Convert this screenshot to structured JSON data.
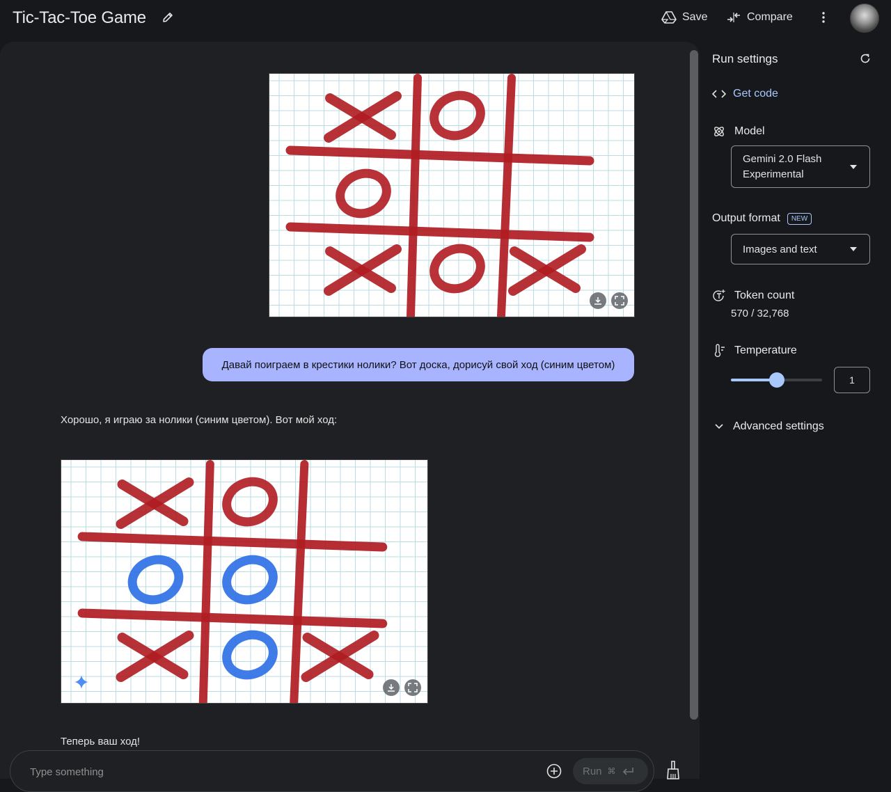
{
  "header": {
    "title": "Tic-Tac-Toe Game",
    "save_label": "Save",
    "compare_label": "Compare"
  },
  "chat": {
    "user_message": "Давай поиграем в крестики нолики? Вот доска, дорисуй свой ход (синим цветом)",
    "model_reply": "Хорошо, я играю за нолики (синим цветом). Вот мой ход:",
    "model_footer": "Теперь ваш ход!",
    "board_before": [
      "X",
      "O",
      "",
      "O",
      "",
      "",
      "X",
      "O",
      "X"
    ],
    "board_after": [
      "X",
      "O",
      "",
      "O",
      "O",
      "",
      "X",
      "O",
      "X"
    ],
    "board_after_blue": [
      false,
      false,
      false,
      true,
      true,
      false,
      false,
      true,
      false
    ],
    "colors": {
      "red": "#b01c22",
      "blue": "#2b6ee6"
    }
  },
  "input": {
    "placeholder": "Type something",
    "run_label": "Run",
    "run_shortcut": "⌘"
  },
  "settings": {
    "title": "Run settings",
    "get_code": "Get code",
    "model_label": "Model",
    "model_value_line1": "Gemini 2.0 Flash",
    "model_value_line2": "Experimental",
    "output_format_label": "Output format",
    "new_badge": "NEW",
    "output_format_value": "Images and text",
    "token_count_label": "Token count",
    "token_count_value": "570 / 32,768",
    "temperature_label": "Temperature",
    "temperature_value": "1",
    "temperature_fraction": 0.5,
    "advanced_label": "Advanced settings"
  }
}
